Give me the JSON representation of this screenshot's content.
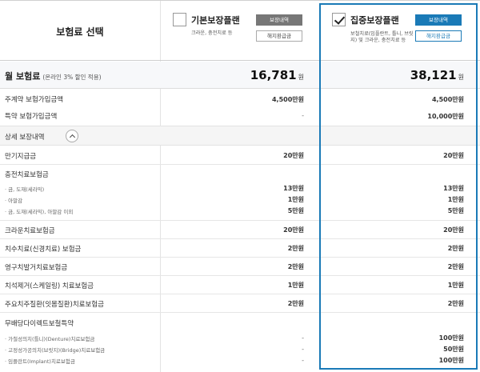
{
  "header": {
    "title": "보험료 선택",
    "plans": [
      {
        "name": "기본보장플랜",
        "desc": "크라운, 충전치료 등",
        "detail_btn": "보장내역",
        "refund_btn": "해지환급금",
        "checked": false
      },
      {
        "name": "집중보장플랜",
        "desc": "보철치료(임플란트, 틀니, 브릿지) 및 크라운, 충전치료 등",
        "detail_btn": "보장내역",
        "refund_btn": "해지환급금",
        "checked": true
      }
    ]
  },
  "premium": {
    "label": "월 보험료",
    "sub": "(온라인 3% 할인 적용)",
    "values": [
      "16,781",
      "38,121"
    ],
    "unit": "원"
  },
  "rows": [
    {
      "label": "주계약 보험가입금액",
      "v1": "4,500만원",
      "v2": "4,500만원"
    },
    {
      "label": "특약 보험가입금액",
      "v1": "-",
      "v2": "10,000만원"
    }
  ],
  "details": {
    "title": "상세 보장내역",
    "maturity": {
      "label": "만기지급금",
      "v1": "20만원",
      "v2": "20만원"
    },
    "filling": {
      "label": "충전치료보험금",
      "items": [
        {
          "label": "· 금, 도재(세라믹)",
          "v1": "13만원",
          "v2": "13만원"
        },
        {
          "label": "· 아말감",
          "v1": "1만원",
          "v2": "1만원"
        },
        {
          "label": "· 금, 도재(세라믹), 아말감 이외",
          "v1": "5만원",
          "v2": "5만원"
        }
      ]
    },
    "simple": [
      {
        "label": "크라운치료보험금",
        "v1": "20만원",
        "v2": "20만원"
      },
      {
        "label": "치수치료(신경치료) 보험금",
        "v1": "2만원",
        "v2": "2만원"
      },
      {
        "label": "영구치발거치료보험금",
        "v1": "2만원",
        "v2": "2만원"
      },
      {
        "label": "치석제거(스케일링) 치료보험금",
        "v1": "1만원",
        "v2": "1만원"
      },
      {
        "label": "주요치주질환(잇몸질환)치료보험금",
        "v1": "2만원",
        "v2": "2만원"
      }
    ],
    "prosthetic": {
      "label": "무배당다이렉트보철특약",
      "items": [
        {
          "label": "· 가철성의치(틀니)(Denture)치료보험금",
          "v1": "-",
          "v2": "100만원"
        },
        {
          "label": "· 고정성가공의치(브릿지)(Bridge)치료보험금",
          "v1": "-",
          "v2": "50만원"
        },
        {
          "label": "· 임플란트(Implant)치료보험금",
          "v1": "-",
          "v2": "100만원"
        }
      ]
    }
  }
}
